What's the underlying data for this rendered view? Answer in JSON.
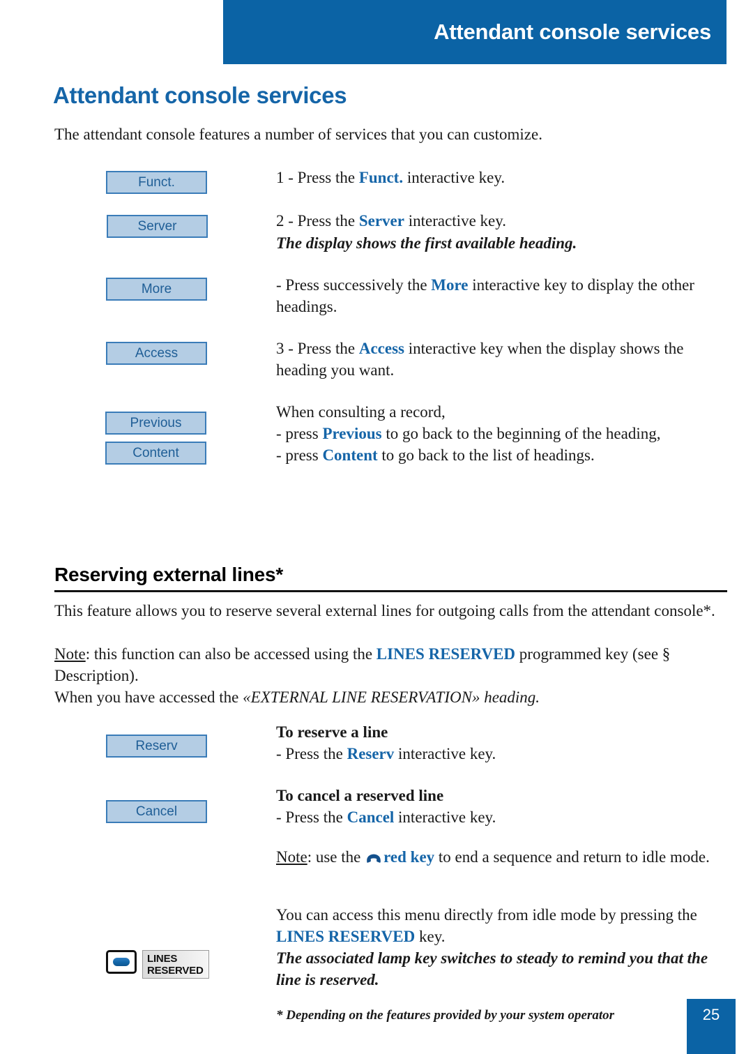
{
  "header": {
    "banner_title": "Attendant console services",
    "banner_color": "#0b63a5"
  },
  "page": {
    "title": "Attendant console services",
    "title_color": "#1565a8",
    "intro": "The attendant console features a number of services that you can customize."
  },
  "softkeys": [
    {
      "label": "Funct.",
      "name": "funct"
    },
    {
      "label": "Server",
      "name": "server"
    },
    {
      "label": "More",
      "name": "more"
    },
    {
      "label": "Access",
      "name": "access"
    },
    {
      "label": "Previous",
      "name": "previous"
    },
    {
      "label": "Content",
      "name": "content"
    },
    {
      "label": "Reserv",
      "name": "reserv"
    },
    {
      "label": "Cancel",
      "name": "cancel"
    }
  ],
  "steps": {
    "step1_pre": "1 - Press the ",
    "step1_key": "Funct.",
    "step1_post": " interactive key.",
    "step2_pre": "2 - Press the ",
    "step2_key": "Server",
    "step2_post": " interactive key.",
    "step2_note": "The display shows the first available heading.",
    "step_more_pre": "- Press successively the ",
    "step_more_key": "More",
    "step_more_post": " interactive key to display the other headings.",
    "step3_pre": "3 - Press the ",
    "step3_key": "Access",
    "step3_post": " interactive key when the display shows the heading you want.",
    "record_intro": "When consulting a record,",
    "record_prev_pre": "- press ",
    "record_prev_key": "Previous",
    "record_prev_post": " to go back to the beginning of the heading,",
    "record_content_pre": "- press ",
    "record_content_key": "Content",
    "record_content_post": " to go back to the list of headings."
  },
  "section": {
    "heading": "Reserving external lines*",
    "para1": "This feature allows you to reserve several external lines for outgoing calls from the attendant console*.",
    "note_label": "Note",
    "note_pre": ": this function can also be accessed using the ",
    "note_key": "LINES RESERVED",
    "note_post": " programmed key (see § Description).",
    "accessed_pre": "When you have accessed the ",
    "accessed_italic": "«EXTERNAL LINE RESERVATION» heading.",
    "reserve_head": "To reserve a line",
    "reserve_pre": "- Press the ",
    "reserve_key": "Reserv",
    "reserve_post": " interactive key.",
    "cancel_head": "To cancel a reserved line",
    "cancel_pre": "- Press the ",
    "cancel_key": "Cancel",
    "cancel_post": " interactive key.",
    "redkey_label": "Note",
    "redkey_pre": ": use the ",
    "redkey_icon": "handset-icon",
    "redkey_key": "red key",
    "redkey_post": " to end a sequence and return to idle mode.",
    "direct_pre": "You can access this menu directly from idle mode by pressing the ",
    "direct_key": "LINES RESERVED",
    "direct_post": " key.",
    "lamp_note": "The associated lamp key switches to steady to remind you that the line is reserved."
  },
  "programmed_key": {
    "label_line1": "LINES",
    "label_line2": "RESERVED",
    "lamp_color": "#1166a8"
  },
  "footer": {
    "footnote": "* Depending on the features provided by your system operator",
    "page_number": "25"
  }
}
